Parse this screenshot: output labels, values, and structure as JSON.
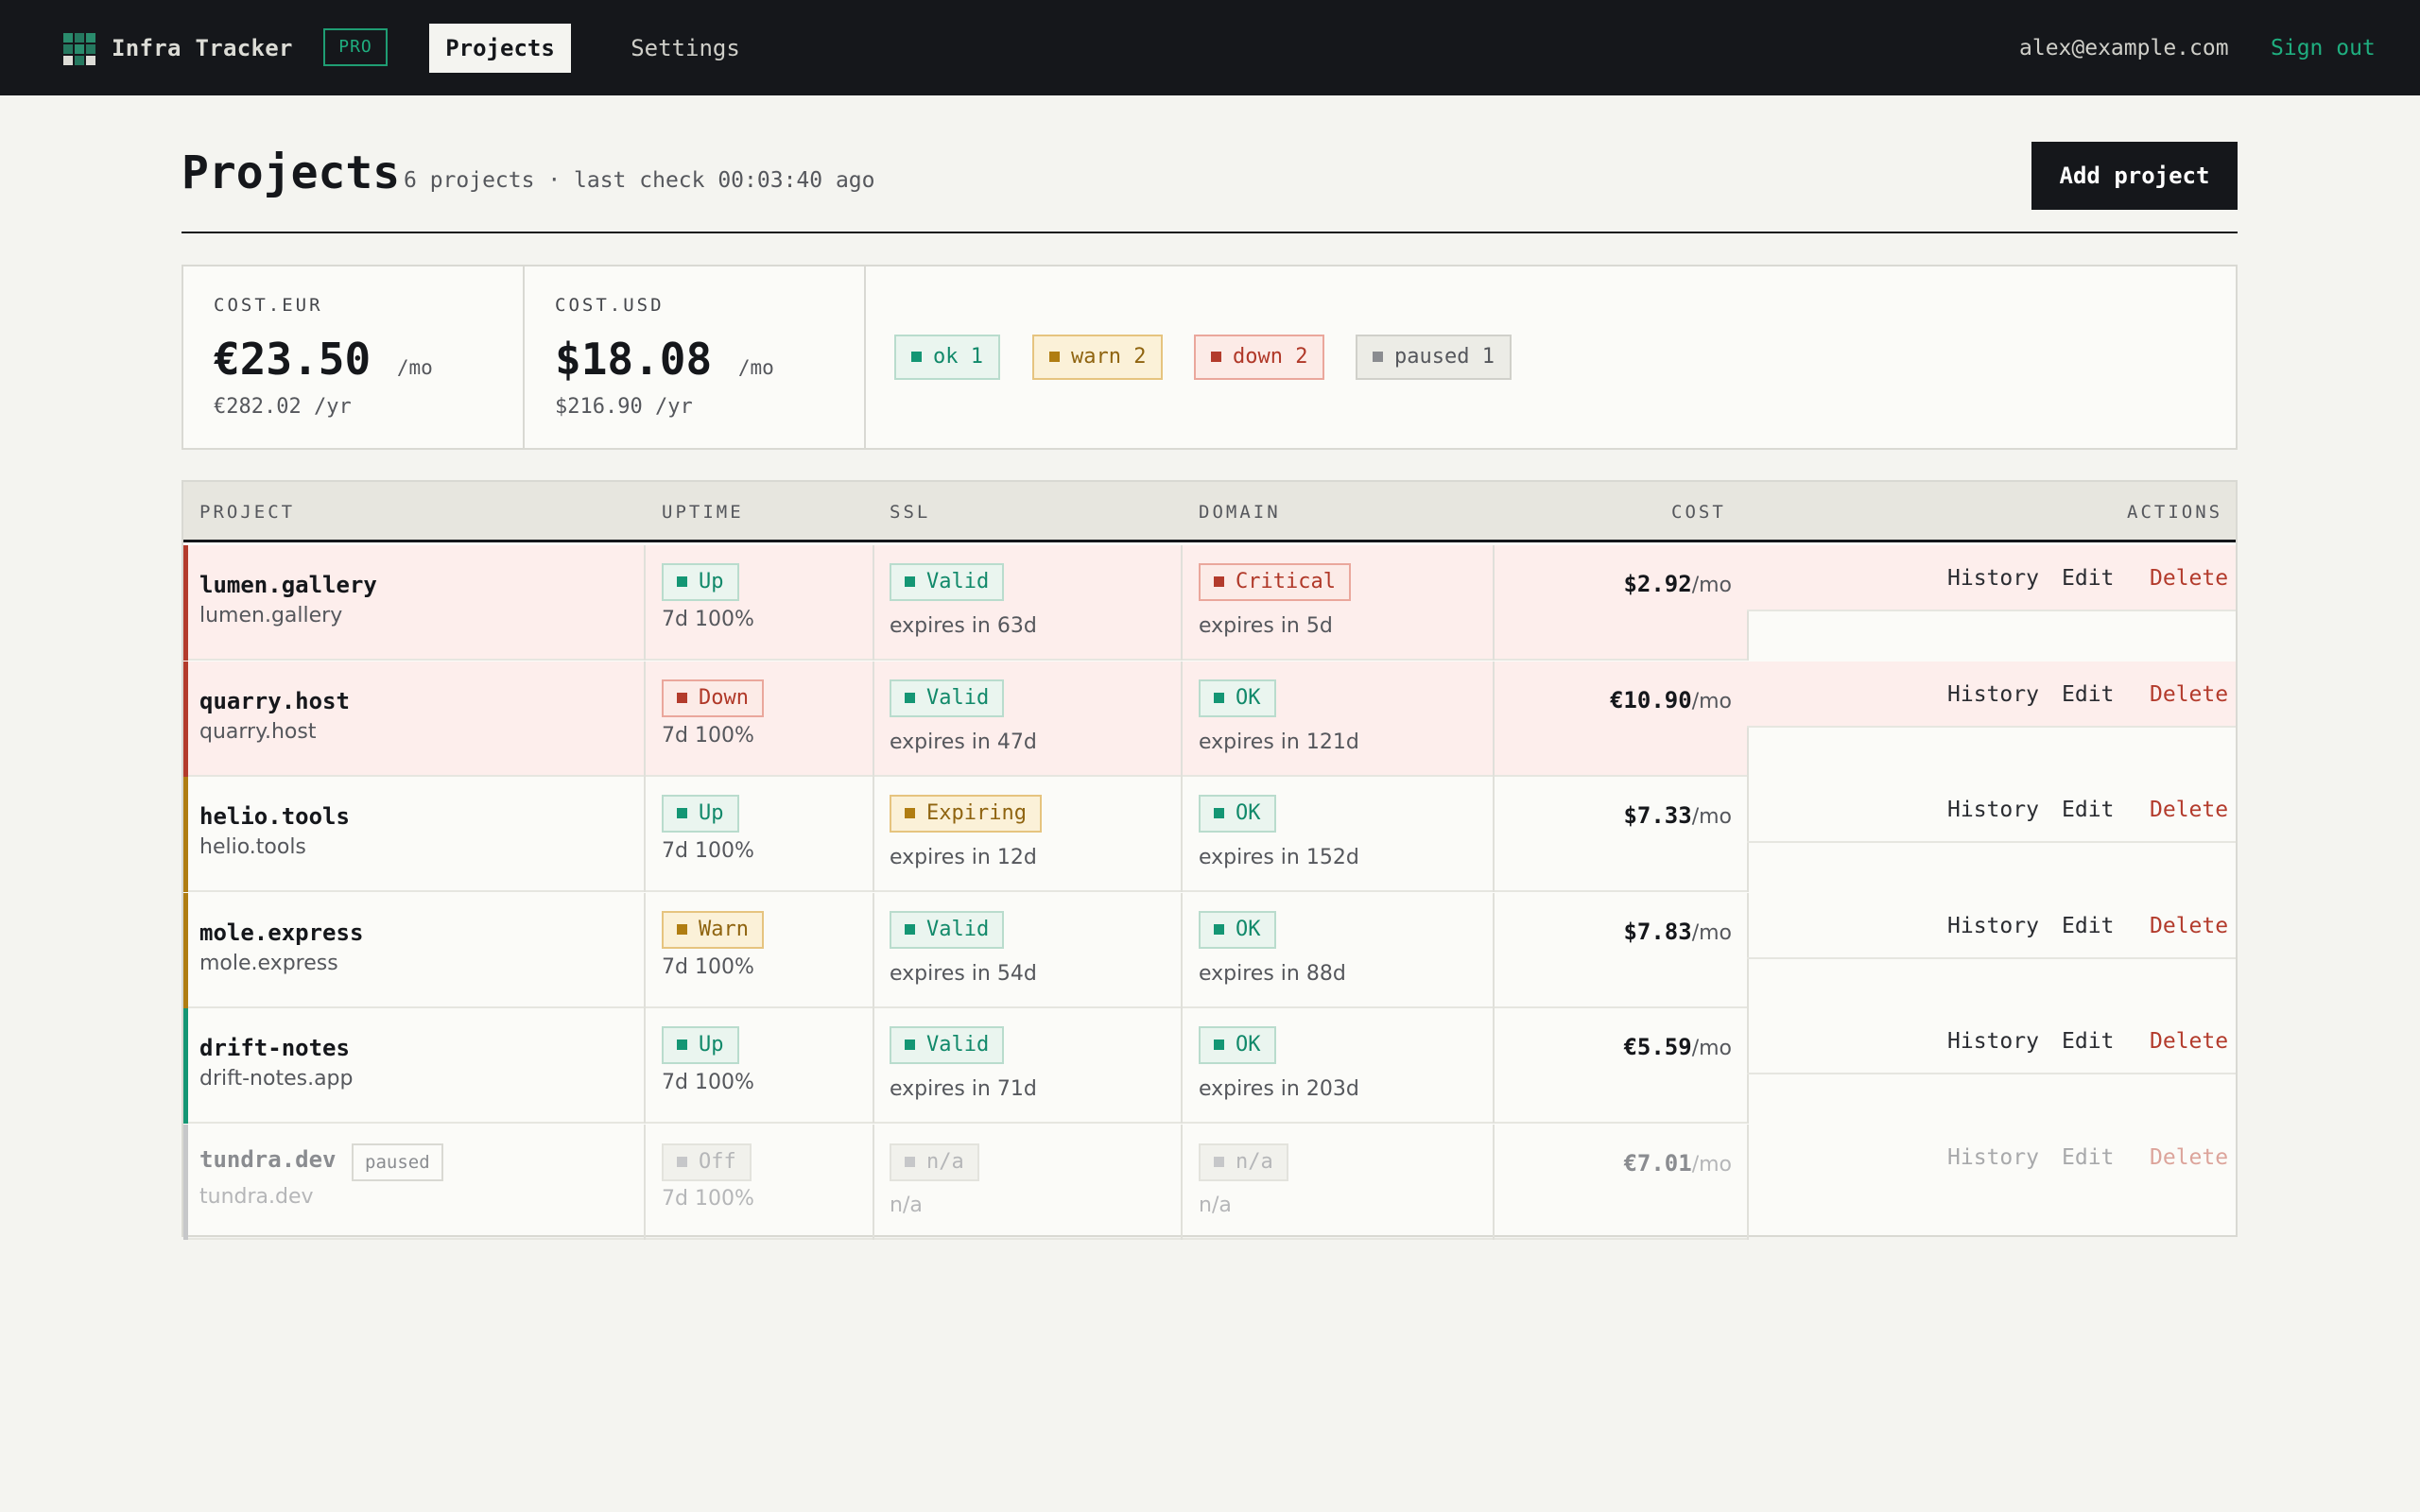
{
  "app": {
    "name": "Infra Tracker",
    "plan": "PRO"
  },
  "nav": {
    "projects": "Projects",
    "settings": "Settings"
  },
  "user": {
    "email": "alex@example.com",
    "sign_out": "Sign out"
  },
  "page": {
    "title": "Projects",
    "subtitle": "6 projects · last check 00:03:40 ago",
    "add_button": "Add project"
  },
  "summary": {
    "eur": {
      "label": "COST.EUR",
      "monthly": "€23.50",
      "per_mo": "/mo",
      "yearly": "€282.02 /yr"
    },
    "usd": {
      "label": "COST.USD",
      "monthly": "$18.08",
      "per_mo": "/mo",
      "yearly": "$216.90 /yr"
    },
    "status_counts": [
      {
        "label": "ok 1",
        "kind": "ok"
      },
      {
        "label": "warn 2",
        "kind": "warn"
      },
      {
        "label": "down 2",
        "kind": "bad"
      },
      {
        "label": "paused 1",
        "kind": "muted"
      }
    ]
  },
  "table": {
    "headers": {
      "project": "PROJECT",
      "uptime": "UPTIME",
      "ssl": "SSL",
      "domain": "DOMAIN",
      "cost": "COST",
      "actions": "ACTIONS"
    },
    "actions": {
      "history": "History",
      "edit": "Edit",
      "delete": "Delete"
    },
    "rows": [
      {
        "name": "lumen.gallery",
        "domain": "lumen.gallery",
        "accent": "#b33b2c",
        "highlight": true,
        "uptime": {
          "label": "Up",
          "kind": "ok",
          "detail": "7d 100%"
        },
        "ssl": {
          "label": "Valid",
          "kind": "ok",
          "detail": "expires in 63d"
        },
        "dom": {
          "label": "Critical",
          "kind": "bad",
          "detail": "expires in 5d"
        },
        "cost": "$2.92",
        "per": "/mo"
      },
      {
        "name": "quarry.host",
        "domain": "quarry.host",
        "accent": "#b33b2c",
        "highlight": true,
        "uptime": {
          "label": "Down",
          "kind": "bad",
          "detail": "7d 100%"
        },
        "ssl": {
          "label": "Valid",
          "kind": "ok",
          "detail": "expires in 47d"
        },
        "dom": {
          "label": "OK",
          "kind": "ok",
          "detail": "expires in 121d"
        },
        "cost": "€10.90",
        "per": "/mo"
      },
      {
        "name": "helio.tools",
        "domain": "helio.tools",
        "accent": "#b07d12",
        "highlight": false,
        "uptime": {
          "label": "Up",
          "kind": "ok",
          "detail": "7d 100%"
        },
        "ssl": {
          "label": "Expiring",
          "kind": "warn",
          "detail": "expires in 12d"
        },
        "dom": {
          "label": "OK",
          "kind": "ok",
          "detail": "expires in 152d"
        },
        "cost": "$7.33",
        "per": "/mo"
      },
      {
        "name": "mole.express",
        "domain": "mole.express",
        "accent": "#b07d12",
        "highlight": false,
        "uptime": {
          "label": "Warn",
          "kind": "warn",
          "detail": "7d 100%"
        },
        "ssl": {
          "label": "Valid",
          "kind": "ok",
          "detail": "expires in 54d"
        },
        "dom": {
          "label": "OK",
          "kind": "ok",
          "detail": "expires in 88d"
        },
        "cost": "$7.83",
        "per": "/mo"
      },
      {
        "name": "drift-notes",
        "domain": "drift-notes.app",
        "accent": "#149674",
        "highlight": false,
        "uptime": {
          "label": "Up",
          "kind": "ok",
          "detail": "7d 100%"
        },
        "ssl": {
          "label": "Valid",
          "kind": "ok",
          "detail": "expires in 71d"
        },
        "dom": {
          "label": "OK",
          "kind": "ok",
          "detail": "expires in 203d"
        },
        "cost": "€5.59",
        "per": "/mo"
      },
      {
        "name": "tundra.dev",
        "domain": "tundra.dev",
        "accent": "#c6c7c9",
        "highlight": false,
        "paused": true,
        "paused_label": "paused",
        "uptime": {
          "label": "Off",
          "kind": "off",
          "detail": "7d 100%"
        },
        "ssl": {
          "label": "n/a",
          "kind": "off",
          "detail": "n/a"
        },
        "dom": {
          "label": "n/a",
          "kind": "off",
          "detail": "n/a"
        },
        "cost": "€7.01",
        "per": "/mo"
      }
    ]
  },
  "colors": {
    "topbar": "#15171b",
    "accent_green": "#1fae7f",
    "danger": "#b33b2c",
    "warning": "#b07d12",
    "row_highlight": "#fdeeec"
  }
}
